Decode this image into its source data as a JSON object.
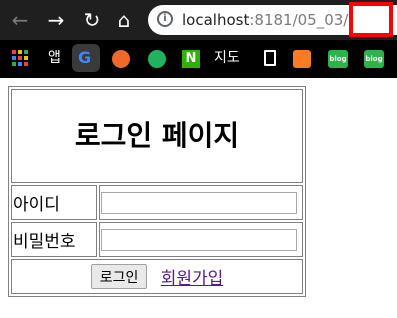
{
  "browser": {
    "url_host": "localhost",
    "url_rest": ":8181/05_03/",
    "bookmarks": {
      "app_label": "앱",
      "map_label": "지도",
      "blog1_label": "blog",
      "blog2_label": "blog"
    },
    "icons": {
      "back": "back-arrow-icon",
      "forward": "forward-arrow-icon",
      "reload": "reload-icon",
      "home": "home-icon",
      "info": "info-icon",
      "apps": "apps-grid-icon",
      "google": "google-icon",
      "document": "document-icon"
    },
    "highlight_color": "#ff0000"
  },
  "login_page": {
    "title": "로그인 페이지",
    "id_label": "아이디",
    "password_label": "비밀번호",
    "id_value": "",
    "password_value": "",
    "login_button": "로그인",
    "signup_link": "회원가입"
  }
}
